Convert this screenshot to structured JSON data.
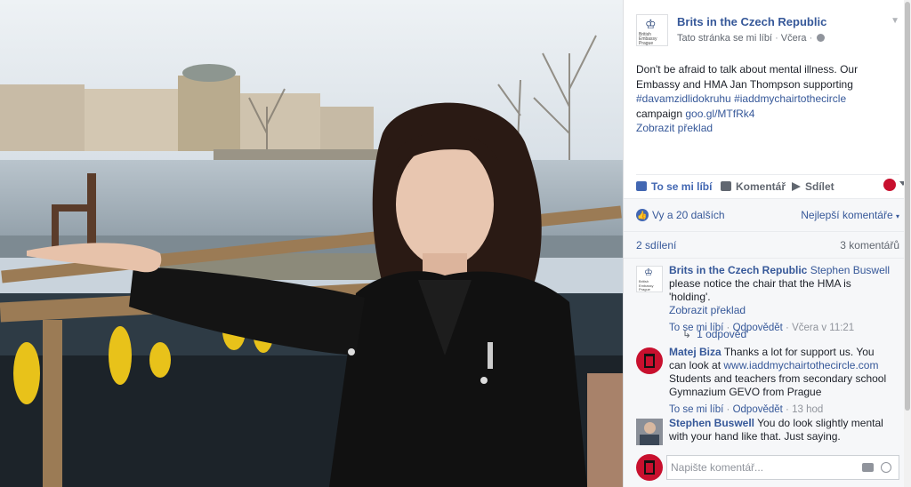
{
  "post": {
    "page_name": "Brits in the Czech Republic",
    "logo_text": "British Embassy Prague",
    "meta_liked": "Tato stránka se mi líbí",
    "meta_dot": "·",
    "meta_time": "Včera",
    "text_line1": "Don't be afraid to talk about mental illness. Our Embassy and HMA Jan Thompson supporting",
    "hashtag1": "#davamzidlidokruhu",
    "hashtag2": "#iaddmychairtothecircle",
    "text_campaign": "campaign",
    "short_link": "goo.gl/MTfRk4",
    "translate": "Zobrazit překlad"
  },
  "actions": {
    "like": "To se mi líbí",
    "comment": "Komentář",
    "share": "Sdílet"
  },
  "stats": {
    "likes": "Vy a 20 dalších",
    "sort": "Nejlepší komentáře",
    "shares": "2 sdílení",
    "comments": "3 komentářů"
  },
  "comments": [
    {
      "author": "Brits in the Czech Republic",
      "mention": "Stephen Buswell",
      "text": "please notice the chair that the HMA is 'holding'.",
      "translate": "Zobrazit překlad",
      "like": "To se mi líbí",
      "reply": "Odpovědět",
      "time": "Včera v 11:21",
      "replies": "1 odpověď"
    },
    {
      "author": "Matej Biza",
      "text_a": "Thanks a lot for support us. You can look at",
      "link": "www.iaddmychairtothecircle.com",
      "text_b": "Students and teachers from secondary school Gymnazium GEVO from Prague",
      "like": "To se mi líbí",
      "reply": "Odpovědět",
      "time": "13 hod"
    },
    {
      "author": "Stephen Buswell",
      "text": "You do look slightly mental with your hand like that. Just saying."
    }
  ],
  "composer": {
    "placeholder": "Napište komentář..."
  },
  "icons": {
    "like": "thumbs-up-icon",
    "comment": "comment-icon",
    "share": "share-icon",
    "camera": "camera-icon",
    "emoji": "emoji-icon",
    "globe": "globe-icon"
  },
  "colors": {
    "link": "#365899",
    "like_blue": "#4267b2",
    "embassy_red": "#c8102e"
  }
}
